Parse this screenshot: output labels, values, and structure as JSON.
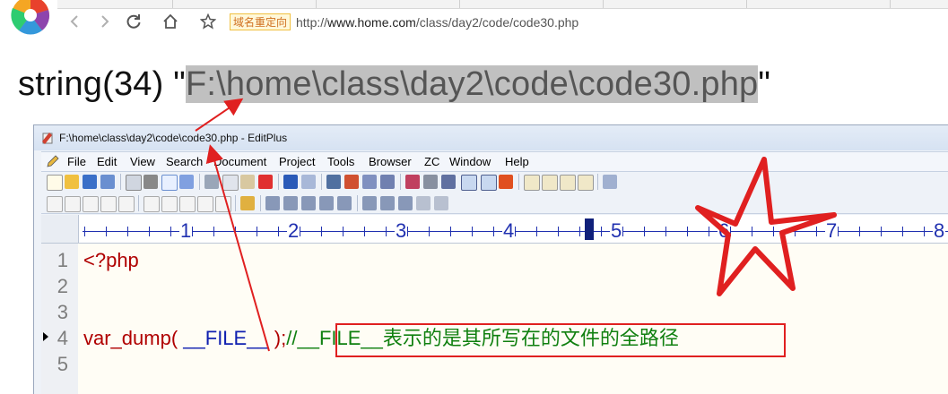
{
  "browser": {
    "chip_text": "域名重定向",
    "url_prefix": "http://",
    "url_host": "www.home.com",
    "url_path": "/class/day2/code/code30.php"
  },
  "output": {
    "prefix": "string(34) \"",
    "path": "F:\\home\\class\\day2\\code\\code30.php",
    "suffix": "\""
  },
  "editplus": {
    "title": "F:\\home\\class\\day2\\code\\code30.php - EditPlus",
    "menu": [
      "File",
      "Edit",
      "View",
      "Search",
      "Document",
      "Project",
      "Tools",
      "Browser",
      "ZC",
      "Window",
      "Help"
    ],
    "ruler_numbers": [
      "1",
      "2",
      "3",
      "4",
      "5",
      "6",
      "7",
      "8"
    ],
    "line_numbers": [
      "1",
      "2",
      "3",
      "4",
      "5"
    ],
    "code": {
      "line1": "<?php",
      "line4_func": "var_dump( ",
      "line4_const": "__FILE__",
      "line4_close": " );",
      "line4_comment": "//__FILE__表示的是其所写在的文件的全路径"
    }
  },
  "colors": {
    "keyword": "#b00000",
    "constant": "#1020b0",
    "comment": "#108010",
    "annotation": "#e02020"
  }
}
